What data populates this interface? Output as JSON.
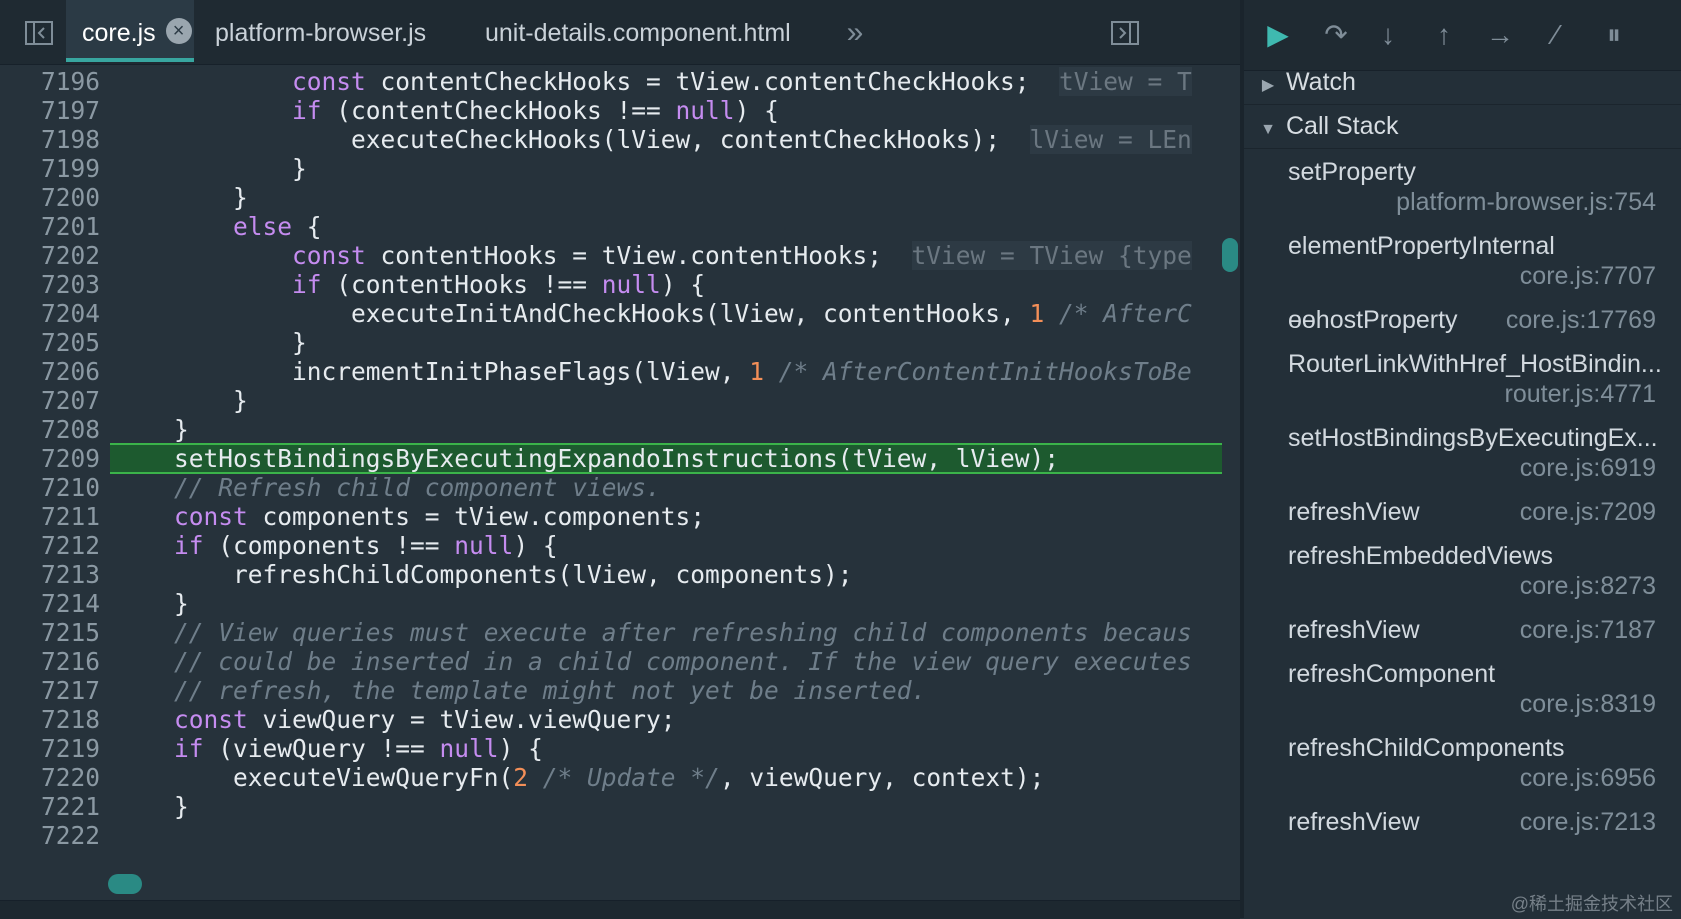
{
  "tabs": [
    {
      "label": "core.js",
      "active": true
    },
    {
      "label": "platform-browser.js",
      "active": false
    },
    {
      "label": "unit-details.component.html",
      "active": false
    }
  ],
  "icons": {
    "toggle_navigator": "sidebar-toggle-icon",
    "close": "×",
    "more_tabs": "»",
    "toggle_debugger": "panel-toggle-icon"
  },
  "code_lines": [
    {
      "n": "7196",
      "parts": [
        [
          "t",
          "            "
        ],
        [
          "kw",
          "const"
        ],
        [
          "t",
          " contentCheckHooks = tView.contentCheckHooks;  "
        ],
        [
          "inl",
          "tView = T"
        ]
      ]
    },
    {
      "n": "7197",
      "parts": [
        [
          "t",
          "            "
        ],
        [
          "kw",
          "if"
        ],
        [
          "t",
          " (contentCheckHooks !== "
        ],
        [
          "kw",
          "null"
        ],
        [
          "t",
          ") {"
        ]
      ]
    },
    {
      "n": "7198",
      "parts": [
        [
          "t",
          "                executeCheckHooks(lView, contentCheckHooks);  "
        ],
        [
          "inl",
          "lView = LEn"
        ]
      ]
    },
    {
      "n": "7199",
      "parts": [
        [
          "t",
          "            }"
        ]
      ]
    },
    {
      "n": "7200",
      "parts": [
        [
          "t",
          "        }"
        ]
      ]
    },
    {
      "n": "7201",
      "parts": [
        [
          "t",
          "        "
        ],
        [
          "kw",
          "else"
        ],
        [
          "t",
          " {"
        ]
      ]
    },
    {
      "n": "7202",
      "parts": [
        [
          "t",
          "            "
        ],
        [
          "kw",
          "const"
        ],
        [
          "t",
          " contentHooks = tView.contentHooks;  "
        ],
        [
          "inl",
          "tView = TView {type"
        ]
      ]
    },
    {
      "n": "7203",
      "parts": [
        [
          "t",
          "            "
        ],
        [
          "kw",
          "if"
        ],
        [
          "t",
          " (contentHooks !== "
        ],
        [
          "kw",
          "null"
        ],
        [
          "t",
          ") {"
        ]
      ]
    },
    {
      "n": "7204",
      "parts": [
        [
          "t",
          "                executeInitAndCheckHooks(lView, contentHooks, "
        ],
        [
          "num",
          "1"
        ],
        [
          "t",
          " "
        ],
        [
          "cm",
          "/* AfterC"
        ]
      ]
    },
    {
      "n": "7205",
      "parts": [
        [
          "t",
          "            }"
        ]
      ]
    },
    {
      "n": "7206",
      "parts": [
        [
          "t",
          "            incrementInitPhaseFlags(lView, "
        ],
        [
          "num",
          "1"
        ],
        [
          "t",
          " "
        ],
        [
          "cm",
          "/* AfterContentInitHooksToBe"
        ]
      ]
    },
    {
      "n": "7207",
      "parts": [
        [
          "t",
          "        }"
        ]
      ]
    },
    {
      "n": "7208",
      "parts": [
        [
          "t",
          "    }"
        ]
      ]
    },
    {
      "n": "7209",
      "hl": true,
      "parts": [
        [
          "t",
          "    setHostBindingsByExecutingExpandoInstructions(tView, lView);"
        ]
      ]
    },
    {
      "n": "7210",
      "parts": [
        [
          "t",
          "    "
        ],
        [
          "cm",
          "// Refresh child component views."
        ]
      ]
    },
    {
      "n": "7211",
      "parts": [
        [
          "t",
          "    "
        ],
        [
          "kw",
          "const"
        ],
        [
          "t",
          " components = tView.components;"
        ]
      ]
    },
    {
      "n": "7212",
      "parts": [
        [
          "t",
          "    "
        ],
        [
          "kw",
          "if"
        ],
        [
          "t",
          " (components !== "
        ],
        [
          "kw",
          "null"
        ],
        [
          "t",
          ") {"
        ]
      ]
    },
    {
      "n": "7213",
      "parts": [
        [
          "t",
          "        refreshChildComponents(lView, components);"
        ]
      ]
    },
    {
      "n": "7214",
      "parts": [
        [
          "t",
          "    }"
        ]
      ]
    },
    {
      "n": "7215",
      "parts": [
        [
          "t",
          "    "
        ],
        [
          "cm",
          "// View queries must execute after refreshing child components becaus"
        ]
      ]
    },
    {
      "n": "7216",
      "parts": [
        [
          "t",
          "    "
        ],
        [
          "cm",
          "// could be inserted in a child component. If the view query executes"
        ]
      ]
    },
    {
      "n": "7217",
      "parts": [
        [
          "t",
          "    "
        ],
        [
          "cm",
          "// refresh, the template might not yet be inserted."
        ]
      ]
    },
    {
      "n": "7218",
      "parts": [
        [
          "t",
          "    "
        ],
        [
          "kw",
          "const"
        ],
        [
          "t",
          " viewQuery = tView.viewQuery;"
        ]
      ]
    },
    {
      "n": "7219",
      "parts": [
        [
          "t",
          "    "
        ],
        [
          "kw",
          "if"
        ],
        [
          "t",
          " (viewQuery !== "
        ],
        [
          "kw",
          "null"
        ],
        [
          "t",
          ") {"
        ]
      ]
    },
    {
      "n": "7220",
      "parts": [
        [
          "t",
          "        executeViewQueryFn("
        ],
        [
          "num",
          "2"
        ],
        [
          "t",
          " "
        ],
        [
          "cm",
          "/* Update */"
        ],
        [
          "t",
          ", viewQuery, context);"
        ]
      ]
    },
    {
      "n": "7221",
      "parts": [
        [
          "t",
          "    }"
        ]
      ]
    },
    {
      "n": "7222",
      "parts": []
    }
  ],
  "debugger_toolbar": {
    "buttons": [
      {
        "name": "resume-icon",
        "glyph": "▶"
      },
      {
        "name": "step-over-icon",
        "glyph": "↷"
      },
      {
        "name": "step-into-icon",
        "glyph": "↓"
      },
      {
        "name": "step-out-icon",
        "glyph": "↑"
      },
      {
        "name": "step-icon",
        "glyph": "→"
      },
      {
        "name": "deactivate-breakpoints-icon",
        "glyph": "⁄"
      },
      {
        "name": "pause-on-exceptions-icon",
        "glyph": "⏸"
      }
    ]
  },
  "sidebar": {
    "watch_label": "Watch",
    "callstack_label": "Call Stack",
    "frames": [
      {
        "fn": "setProperty",
        "loc": "platform-browser.js:754",
        "two_line": true
      },
      {
        "fn": "elementPropertyInternal",
        "loc": "core.js:7707",
        "two_line": true
      },
      {
        "fn": "ɵɵhostProperty",
        "loc": "core.js:17769",
        "two_line": false
      },
      {
        "fn": "RouterLinkWithHref_HostBindin...",
        "loc": "router.js:4771",
        "two_line": true
      },
      {
        "fn": "setHostBindingsByExecutingEx...",
        "loc": "core.js:6919",
        "two_line": true
      },
      {
        "fn": "refreshView",
        "loc": "core.js:7209",
        "two_line": false
      },
      {
        "fn": "refreshEmbeddedViews",
        "loc": "core.js:8273",
        "two_line": true
      },
      {
        "fn": "refreshView",
        "loc": "core.js:7187",
        "two_line": false
      },
      {
        "fn": "refreshComponent",
        "loc": "core.js:8319",
        "two_line": true
      },
      {
        "fn": "refreshChildComponents",
        "loc": "core.js:6956",
        "two_line": true
      },
      {
        "fn": "refreshView",
        "loc": "core.js:7213",
        "two_line": false
      }
    ]
  },
  "watermark": "@稀土掘金技术社区",
  "colors": {
    "accent": "#38a6a0",
    "highlight": "#1d5a2f",
    "keyword": "#c58cf0",
    "number": "#f38f58",
    "comment": "#6f7e8a"
  }
}
